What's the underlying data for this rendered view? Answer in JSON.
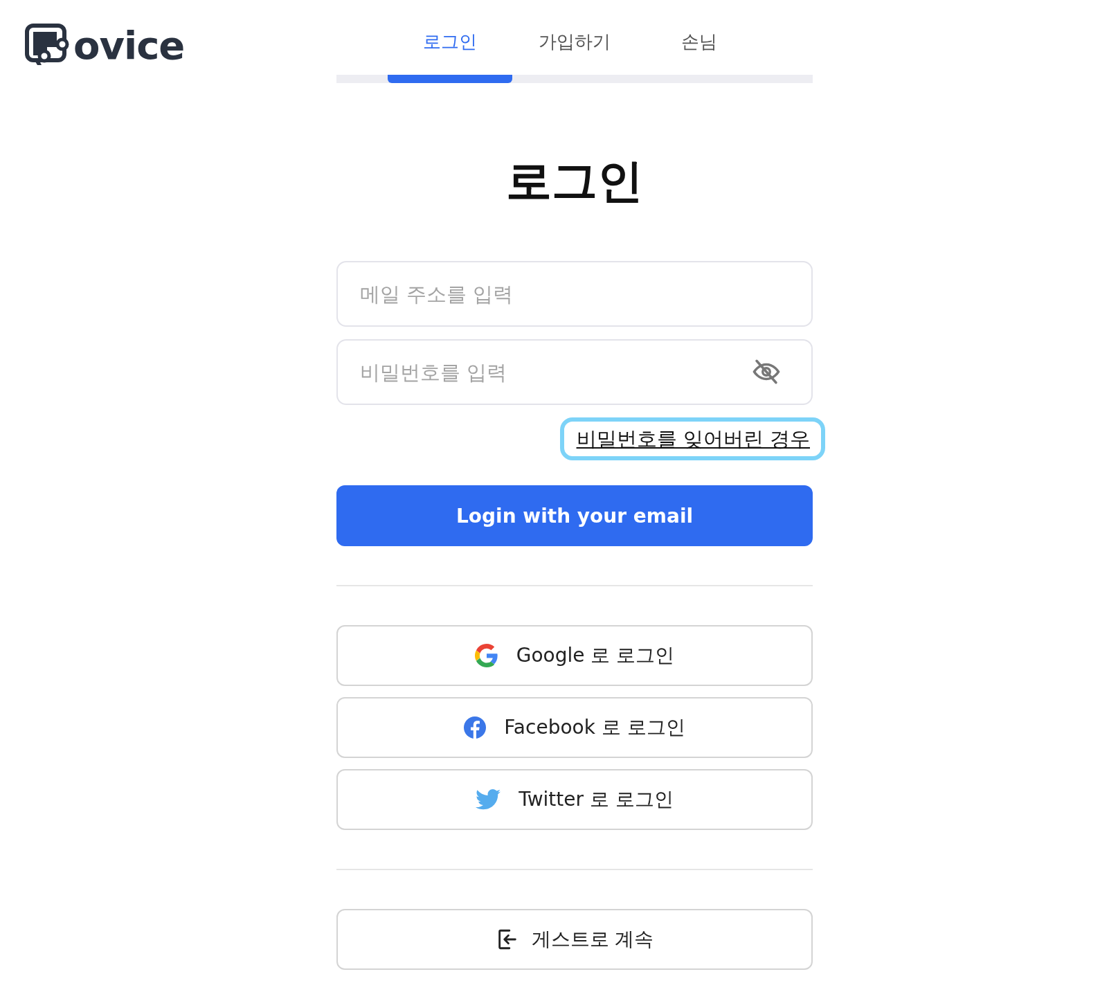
{
  "logo": {
    "text": "ovice"
  },
  "tabs": [
    {
      "label": "로그인",
      "selected": true
    },
    {
      "label": "가입하기",
      "selected": false
    },
    {
      "label": "손님",
      "selected": false
    }
  ],
  "title": "로그인",
  "email_field": {
    "placeholder": "메일 주소를 입력"
  },
  "password_field": {
    "placeholder": "비밀번호를 입력",
    "visible": false
  },
  "forgot_link": {
    "label": "비밀번호를 잊어버린 경우",
    "focused": true
  },
  "login_button": "Login with your email",
  "social_buttons": [
    {
      "kind": "google",
      "label": "Google 로 로그인"
    },
    {
      "kind": "facebook",
      "label": "Facebook 로 로그인"
    },
    {
      "kind": "twitter",
      "label": "Twitter 로 로그인"
    }
  ],
  "guest_button": "게스트로 계속"
}
